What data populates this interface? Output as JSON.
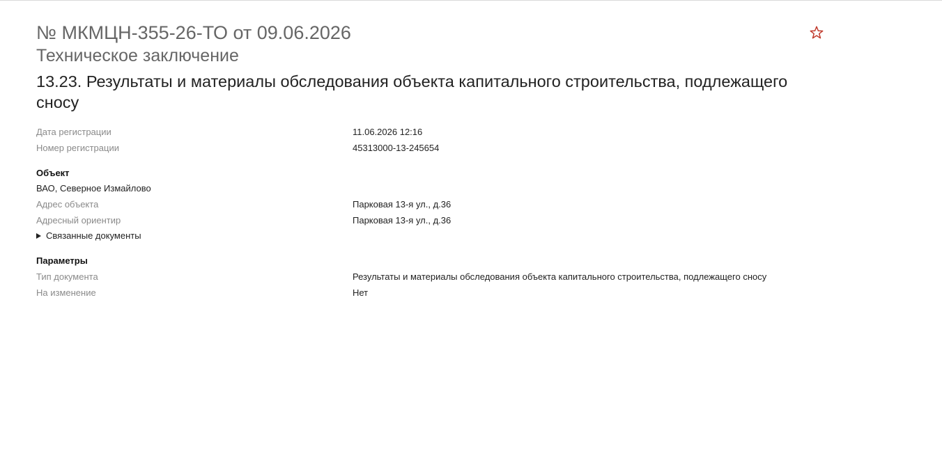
{
  "header": {
    "number": "№ МКМЦН-355-26-ТО от 09.06.2026",
    "type": "Техническое заключение",
    "title": "13.23. Результаты и материалы обследования объекта капитального строительства, подлежащего сносу",
    "favorite_icon": "star-outline-icon",
    "accent_color": "#c0392b"
  },
  "registration": [
    {
      "label": "Дата регистрации",
      "value": "11.06.2026 12:16"
    },
    {
      "label": "Номер регистрации",
      "value": "45313000-13-245654"
    }
  ],
  "object": {
    "heading": "Объект",
    "district": "ВАО, Северное Измайлово",
    "rows": [
      {
        "label": "Адрес объекта",
        "value": "Парковая 13-я ул., д.36"
      },
      {
        "label": "Адресный ориентир",
        "value": "Парковая 13-я ул., д.36"
      }
    ],
    "related_docs_label": "Связанные документы"
  },
  "params": {
    "heading": "Параметры",
    "rows": [
      {
        "label": "Тип документа",
        "value": "Результаты и материалы обследования объекта капитального строительства, подлежащего сносу"
      },
      {
        "label": "На изменение",
        "value": "Нет"
      }
    ]
  }
}
